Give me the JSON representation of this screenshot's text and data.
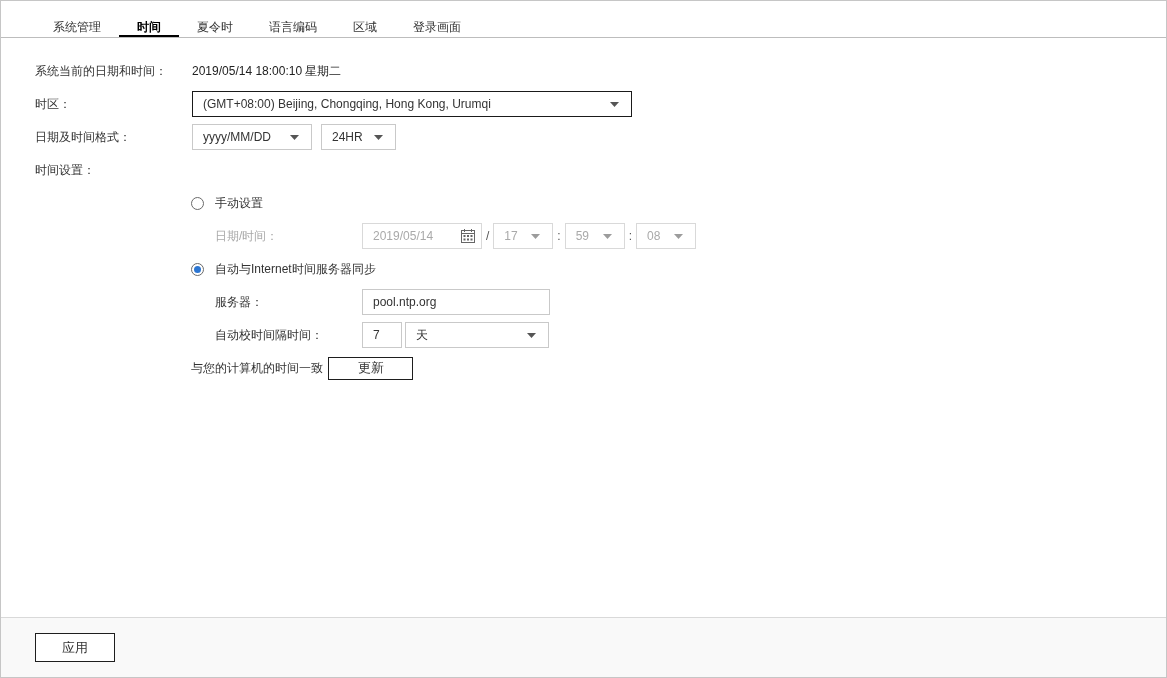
{
  "tabs": [
    {
      "label": "系统管理",
      "selected": false
    },
    {
      "label": "时间",
      "selected": true
    },
    {
      "label": "夏令时",
      "selected": false
    },
    {
      "label": "语言编码",
      "selected": false
    },
    {
      "label": "区域",
      "selected": false
    },
    {
      "label": "登录画面",
      "selected": false
    }
  ],
  "current_datetime": {
    "label": "系统当前的日期和时间：",
    "value": "2019/05/14 18:00:10 星期二"
  },
  "timezone": {
    "label": "时区：",
    "value": "(GMT+08:00) Beijing, Chongqing, Hong Kong, Urumqi",
    "focused": true
  },
  "format": {
    "label": "日期及时间格式：",
    "date_format": "yyyy/MM/DD",
    "time_format": "24HR"
  },
  "time_setting": {
    "label": "时间设置：",
    "options": [
      {
        "kind": "manual",
        "label": "手动设置",
        "selected": false,
        "datetime": {
          "label": "日期/时间：",
          "disabled": true,
          "parts": [
            {
              "kind": "date",
              "value": "2019/05/14"
            },
            {
              "kind": "separator",
              "text": "/"
            },
            {
              "kind": "select",
              "value": "17"
            },
            {
              "kind": "separator",
              "text": ":"
            },
            {
              "kind": "select",
              "value": "59"
            },
            {
              "kind": "separator",
              "text": ":"
            },
            {
              "kind": "select",
              "value": "08"
            }
          ]
        }
      },
      {
        "kind": "ntp",
        "label": "自动与Internet时间服务器同步",
        "selected": true,
        "server": {
          "label": "服务器：",
          "value": "pool.ntp.org"
        },
        "interval": {
          "label": "自动校时间隔时间：",
          "value": "7",
          "unit": "天"
        }
      }
    ]
  },
  "sync": {
    "label": "与您的计算机的时间一致",
    "button": "更新"
  },
  "footer": {
    "apply_button": "应用"
  }
}
